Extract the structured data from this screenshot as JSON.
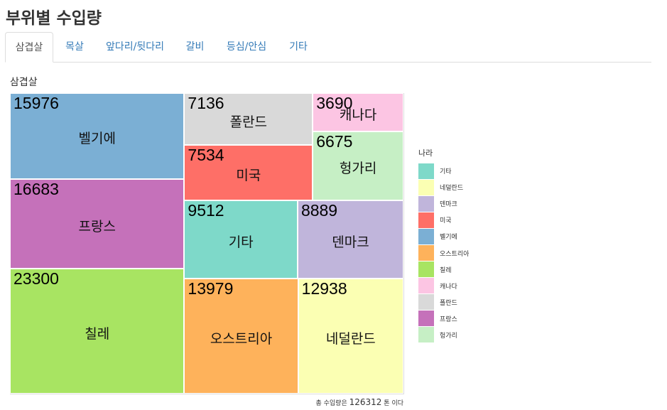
{
  "page": {
    "title": "부위별 수입량"
  },
  "tabs": [
    {
      "label": "삼겹살",
      "active": true
    },
    {
      "label": "목살",
      "active": false
    },
    {
      "label": "앞다리/뒷다리",
      "active": false
    },
    {
      "label": "갈비",
      "active": false
    },
    {
      "label": "등심/안심",
      "active": false
    },
    {
      "label": "기타",
      "active": false
    }
  ],
  "section": {
    "title": "삼겹살"
  },
  "legend": {
    "title": "나라",
    "items": [
      {
        "label": "기타",
        "color": "#7ed9c9"
      },
      {
        "label": "네덜란드",
        "color": "#fbffb3"
      },
      {
        "label": "덴마크",
        "color": "#c0b5db"
      },
      {
        "label": "미국",
        "color": "#fe6f67"
      },
      {
        "label": "벨기에",
        "color": "#7bafd4"
      },
      {
        "label": "오스트리아",
        "color": "#feb25b"
      },
      {
        "label": "칠레",
        "color": "#a8e462"
      },
      {
        "label": "캐나다",
        "color": "#fcc5e3"
      },
      {
        "label": "폴란드",
        "color": "#d9d9d9"
      },
      {
        "label": "프랑스",
        "color": "#c571ba"
      },
      {
        "label": "헝가리",
        "color": "#c6efc5"
      }
    ]
  },
  "chart_data": {
    "type": "treemap",
    "legend_title": "나라",
    "items": [
      {
        "name": "칠레",
        "value": 23300
      },
      {
        "name": "프랑스",
        "value": 16683
      },
      {
        "name": "벨기에",
        "value": 15976
      },
      {
        "name": "오스트리아",
        "value": 13979
      },
      {
        "name": "네덜란드",
        "value": 12938
      },
      {
        "name": "기타",
        "value": 9512
      },
      {
        "name": "덴마크",
        "value": 8889
      },
      {
        "name": "미국",
        "value": 7534
      },
      {
        "name": "폴란드",
        "value": 7136
      },
      {
        "name": "헝가리",
        "value": 6675
      },
      {
        "name": "캐나다",
        "value": 3690
      }
    ],
    "total": 126312
  },
  "footnote": {
    "prefix": "총 수입량은",
    "total": "126312",
    "suffix": "톤 이다"
  }
}
